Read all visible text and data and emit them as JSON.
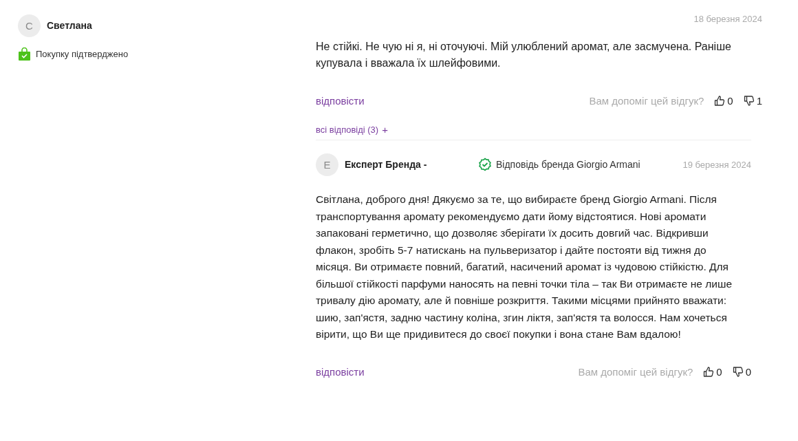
{
  "review": {
    "avatar_letter": "С",
    "author": "Светлана",
    "date": "18 березня 2024",
    "verified_label": "Покупку підтверджено",
    "text": "Не стійкі. Не чую ні я, ні оточуючі. Мій улюблений аромат, але засмучена. Раніше купувала і вважала їх шлейфовими.",
    "reply_link": "відповісти",
    "helpful_question": "Вам допоміг цей відгук?",
    "likes": "0",
    "dislikes": "1",
    "all_replies": "всі відповіді (3)",
    "expand_sign": "+",
    "replies": [
      {
        "avatar_letter": "Е",
        "author": "Експерт Бренда -",
        "badge": "Відповідь бренда Giorgio Armani",
        "date": "19 березня 2024",
        "text": "Світлана, доброго дня! Дякуємо за те, що вибираєте бренд Giorgio Armani. Після транспортування аромату рекомендуємо дати йому відстоятися. Нові аромати запаковані герметично, що дозволяє зберігати їх досить довгий час. Відкривши флакон, зробіть 5-7 натискань на пульверизатор і дайте постояти від тижня до місяця. Ви отримаєте повний, багатий, насичений аромат із чудовою стійкістю. Для більшої стійкості парфуми наносять на певні точки тіла – так Ви отримаєте не лише тривалу дію аромату, але й повніше розкриття. Такими місцями прийнято вважати: шию, зап'ястя, задню частину коліна, згин ліктя, зап'ястя та волосся. Нам хочеться вірити, що Ви ще придивитеся до своєї покупки і вона стане Вам вдалою!",
        "reply_link": "відповісти",
        "helpful_question": "Вам допоміг цей відгук?",
        "likes": "0",
        "dislikes": "0"
      }
    ]
  }
}
